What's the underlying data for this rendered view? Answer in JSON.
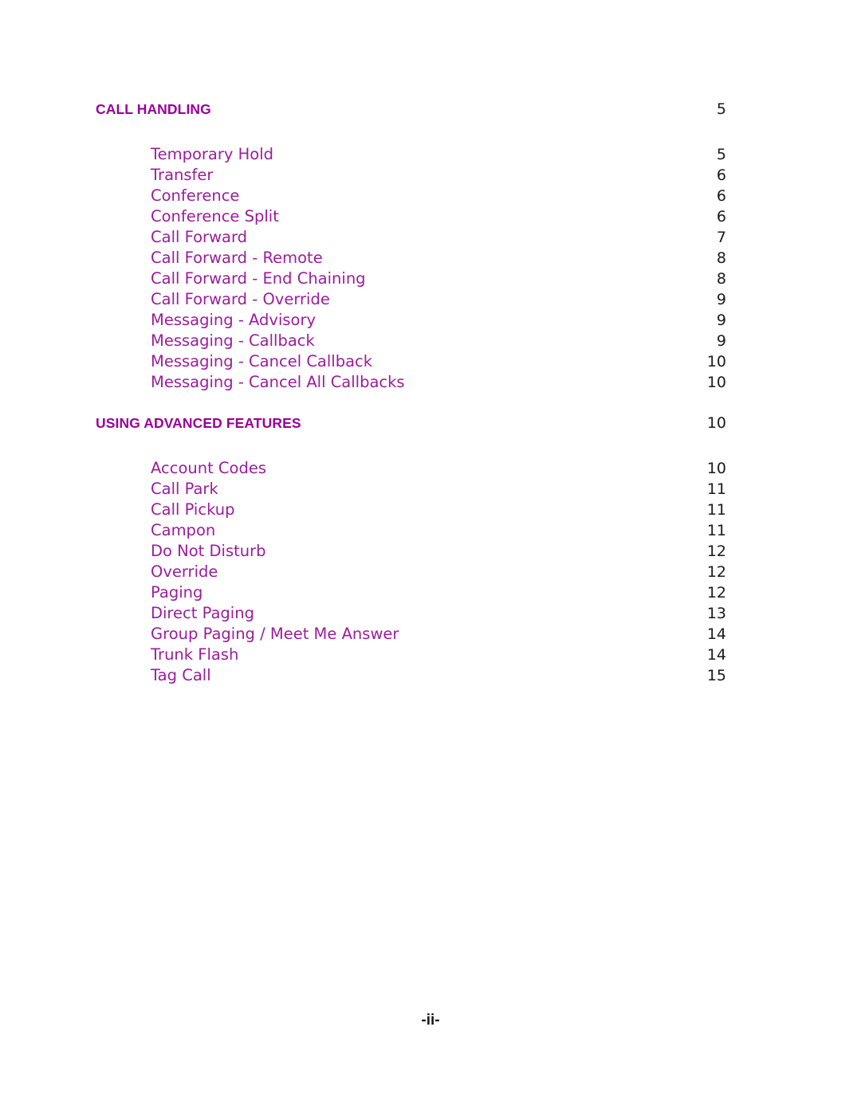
{
  "document": {
    "type": "table-of-contents",
    "page_marker": "-ii-",
    "colors": {
      "heading": "#990099",
      "entry": "#9c1c9c",
      "page_number": "#1a1a1a",
      "background": "#ffffff"
    }
  },
  "sections": [
    {
      "heading": "CALL HANDLING",
      "page": "5",
      "entries": [
        {
          "label": "Temporary Hold",
          "page": "5"
        },
        {
          "label": "Transfer",
          "page": "6"
        },
        {
          "label": "Conference",
          "page": "6"
        },
        {
          "label": "Conference Split",
          "page": "6"
        },
        {
          "label": "Call Forward",
          "page": "7"
        },
        {
          "label": "Call Forward - Remote",
          "page": "8"
        },
        {
          "label": "Call Forward - End Chaining",
          "page": "8"
        },
        {
          "label": "Call Forward - Override",
          "page": "9"
        },
        {
          "label": "Messaging - Advisory",
          "page": "9"
        },
        {
          "label": "Messaging - Callback",
          "page": "9"
        },
        {
          "label": "Messaging - Cancel Callback",
          "page": "10"
        },
        {
          "label": "Messaging - Cancel All Callbacks",
          "page": "10"
        }
      ]
    },
    {
      "heading": "USING ADVANCED FEATURES",
      "page": "10",
      "entries": [
        {
          "label": "Account Codes",
          "page": "10"
        },
        {
          "label": "Call Park",
          "page": "11"
        },
        {
          "label": "Call Pickup",
          "page": "11"
        },
        {
          "label": "Campon",
          "page": "11"
        },
        {
          "label": "Do Not Disturb",
          "page": "12"
        },
        {
          "label": "Override",
          "page": "12"
        },
        {
          "label": "Paging",
          "page": "12"
        },
        {
          "label": "Direct Paging",
          "page": "13"
        },
        {
          "label": "Group Paging / Meet Me Answer",
          "page": "14"
        },
        {
          "label": "Trunk Flash",
          "page": "14"
        },
        {
          "label": "Tag Call",
          "page": "15"
        }
      ]
    }
  ]
}
